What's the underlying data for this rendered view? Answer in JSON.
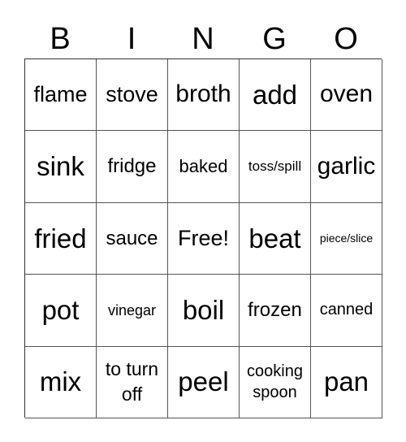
{
  "header": {
    "letters": [
      "B",
      "I",
      "N",
      "G",
      "O"
    ]
  },
  "grid": {
    "rows": [
      [
        "flame",
        "stove",
        "broth",
        "add",
        "oven"
      ],
      [
        "sink",
        "fridge",
        "baked",
        "toss/spill",
        "garlic"
      ],
      [
        "fried",
        "sauce",
        "Free!",
        "beat",
        "piece/slice"
      ],
      [
        "pot",
        "vinegar",
        "boil",
        "frozen",
        "canned"
      ],
      [
        "mix",
        "to turn off",
        "peel",
        "cooking spoon",
        "pan"
      ]
    ]
  }
}
